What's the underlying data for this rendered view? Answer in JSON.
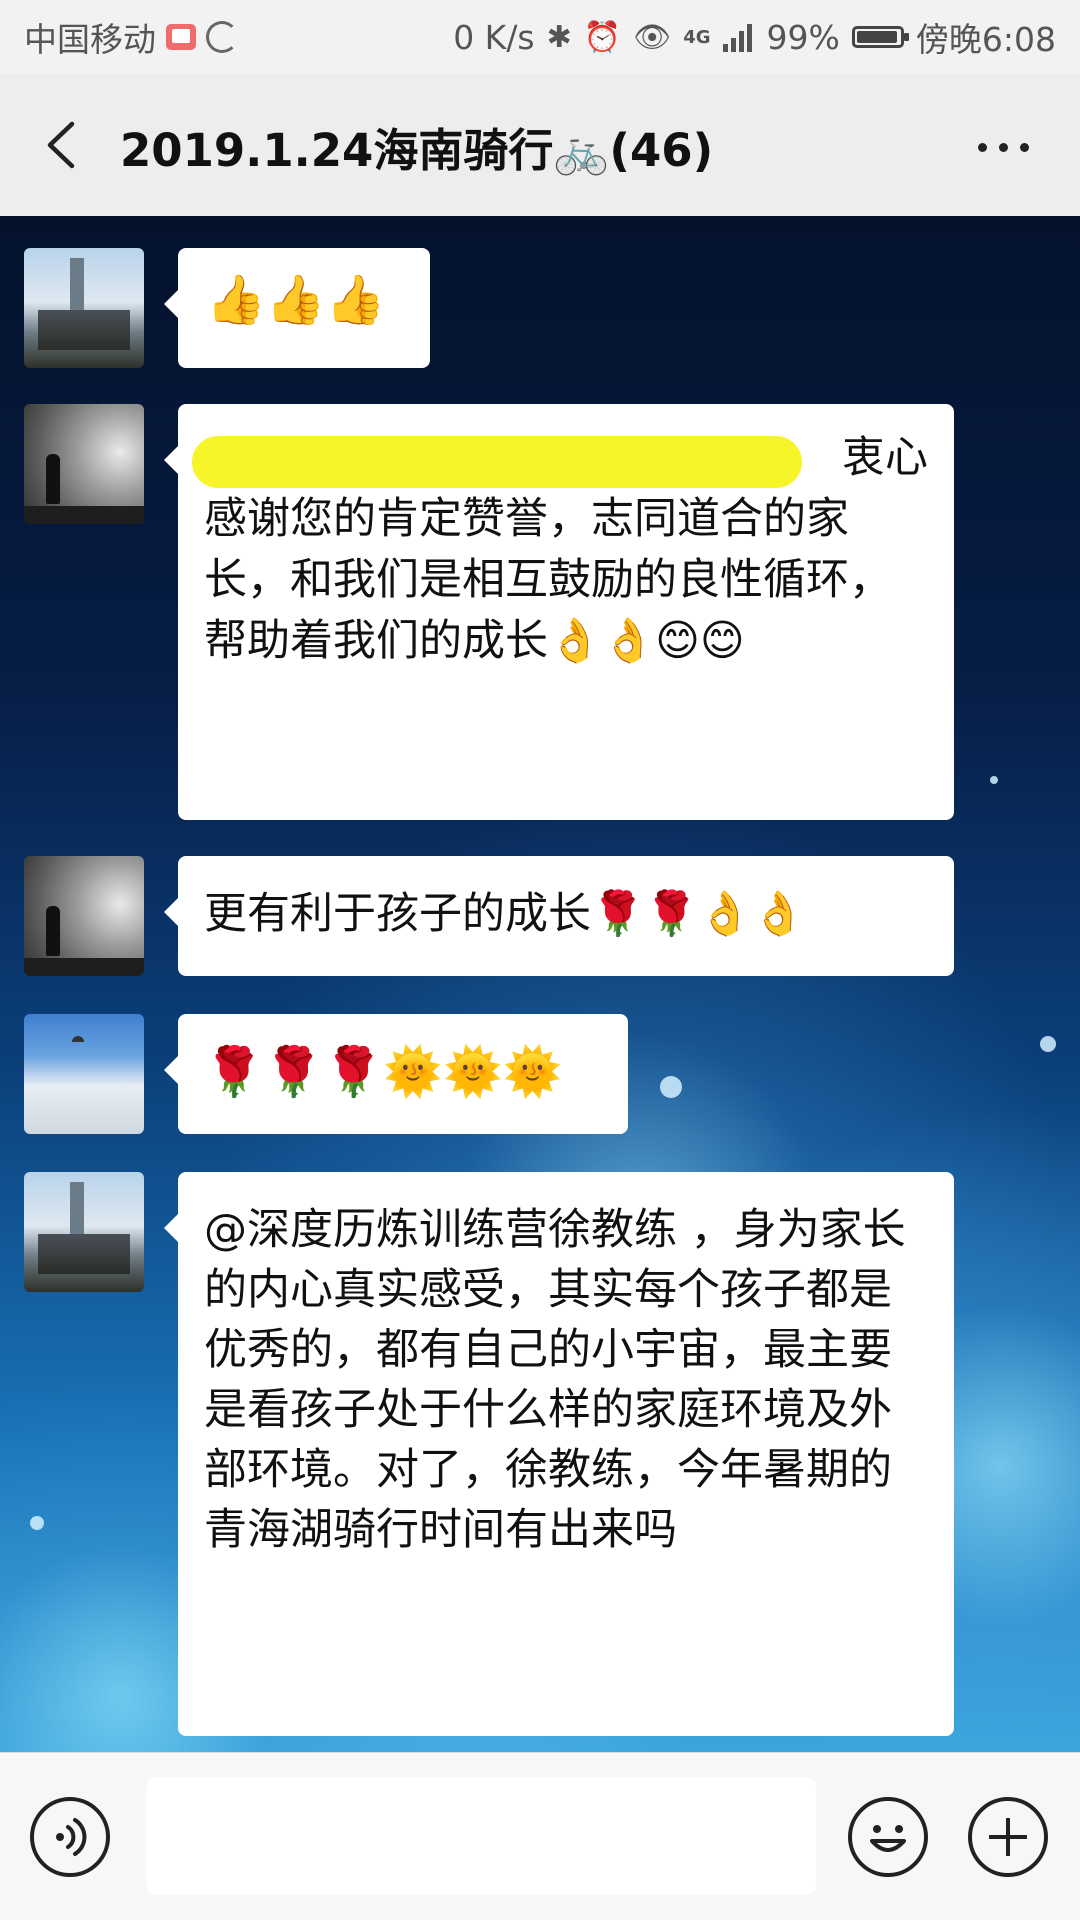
{
  "status_bar": {
    "carrier": "中国移动",
    "speed": "0 K/s",
    "network": "4G",
    "battery": "99%",
    "time": "傍晚6:08",
    "icons": [
      "book-icon",
      "loading-icon",
      "bluetooth-icon",
      "alarm-icon",
      "eye-icon",
      "signal-icon",
      "battery-icon"
    ]
  },
  "header": {
    "title": "2019.1.24海南骑行🚲(46)",
    "back_icon": "back-icon",
    "more_icon": "more-icon"
  },
  "messages": [
    {
      "avatar": "avatar-city",
      "text": "👍👍👍"
    },
    {
      "avatar": "avatar-cloud",
      "mention_redacted": true,
      "text_tail": "衷心",
      "text": "感谢您的肯定赞誉，志同道合的家长，和我们是相互鼓励的良性循环，帮助着我们的成长👌👌😊😊"
    },
    {
      "avatar": "avatar-cloud",
      "text": "更有利于孩子的成长🌹🌹👌👌"
    },
    {
      "avatar": "avatar-sky",
      "text": "🌹🌹🌹🌞🌞🌞"
    },
    {
      "avatar": "avatar-city",
      "text": "@深度历炼训练营徐教练 ，身为家长的内心真实感受，其实每个孩子都是优秀的，都有自己的小宇宙，最主要是看孩子处于什么样的家庭环境及外部环境。对了，徐教练，今年暑期的青海湖骑行时间有出来吗"
    }
  ],
  "bottom_bar": {
    "voice_icon": "voice-icon",
    "input_value": "",
    "emoji_icon": "smiley-icon",
    "plus_icon": "plus-icon"
  }
}
